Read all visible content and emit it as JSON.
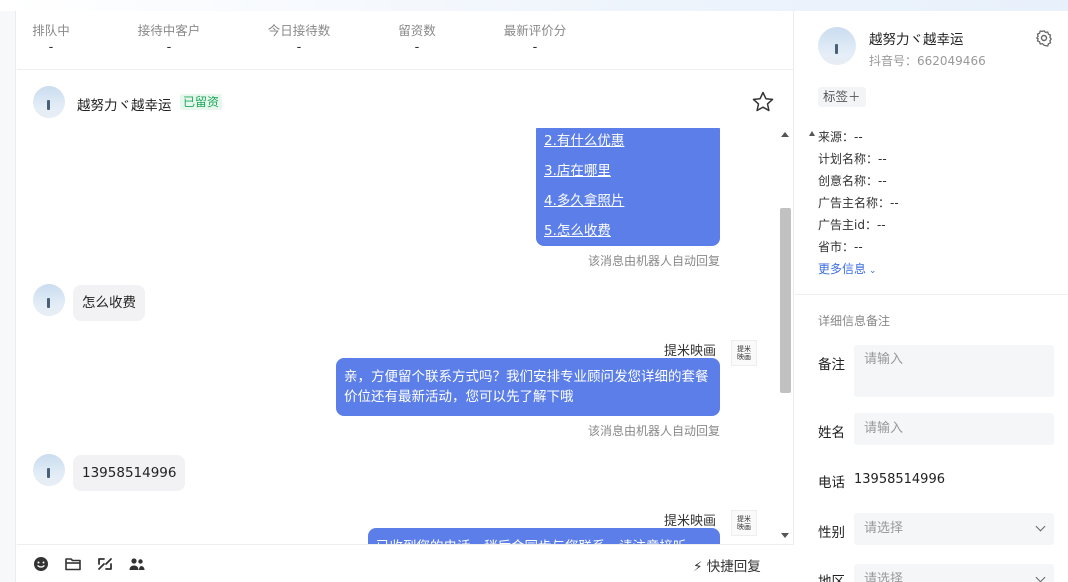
{
  "stats": [
    {
      "label": "排队中",
      "value": "-"
    },
    {
      "label": "接待中客户",
      "value": "-"
    },
    {
      "label": "今日接待数",
      "value": "-"
    },
    {
      "label": "留资数",
      "value": "-"
    },
    {
      "label": "最新评价分",
      "value": "-"
    }
  ],
  "chat": {
    "customer_name": "越努力ヾ越幸运",
    "lead_tag": "已留资",
    "menu_links": [
      "2.有什么优惠",
      "3.店在哪里",
      "4.多久拿照片",
      "5.怎么收费"
    ],
    "auto_reply_note": "该消息由机器人自动回复",
    "customer_msg_1": "怎么收费",
    "sender_name": "提米映画",
    "logo_text": "提米映画",
    "agent_msg_1": "亲，方便留个联系方式吗？我们安排专业顾问发您详细的套餐价位还有最新活动，您可以先了解下哦",
    "customer_msg_2": "13958514996",
    "agent_msg_2_partial": "已收到您的电话，稍后会同步与您联系，请注意接听"
  },
  "toolbar": {
    "icons": [
      "emoji-icon",
      "folder-icon",
      "transfer-icon",
      "users-icon"
    ],
    "quick_reply_label": "快捷回复"
  },
  "side": {
    "name": "越努力ヾ越幸运",
    "douyin_id": "抖音号：662049466",
    "tag_button": "标签＋",
    "info": [
      "来源：--",
      "计划名称：--",
      "创意名称：--",
      "广告主名称：--",
      "广告主id：--",
      "省市：--"
    ],
    "more_info": "更多信息",
    "section_title": "详细信息备注",
    "fields": {
      "note_label": "备注",
      "note_placeholder": "请输入",
      "name_label": "姓名",
      "name_placeholder": "请输入",
      "phone_label": "电话",
      "phone_value": "13958514996",
      "gender_label": "性别",
      "gender_placeholder": "请选择",
      "region_label": "地区",
      "region_placeholder": "请选择"
    }
  },
  "colors": {
    "bubble_agent": "#5b7ee8",
    "tag_green": "#1ba85a",
    "link_blue": "#3d6fe0"
  }
}
